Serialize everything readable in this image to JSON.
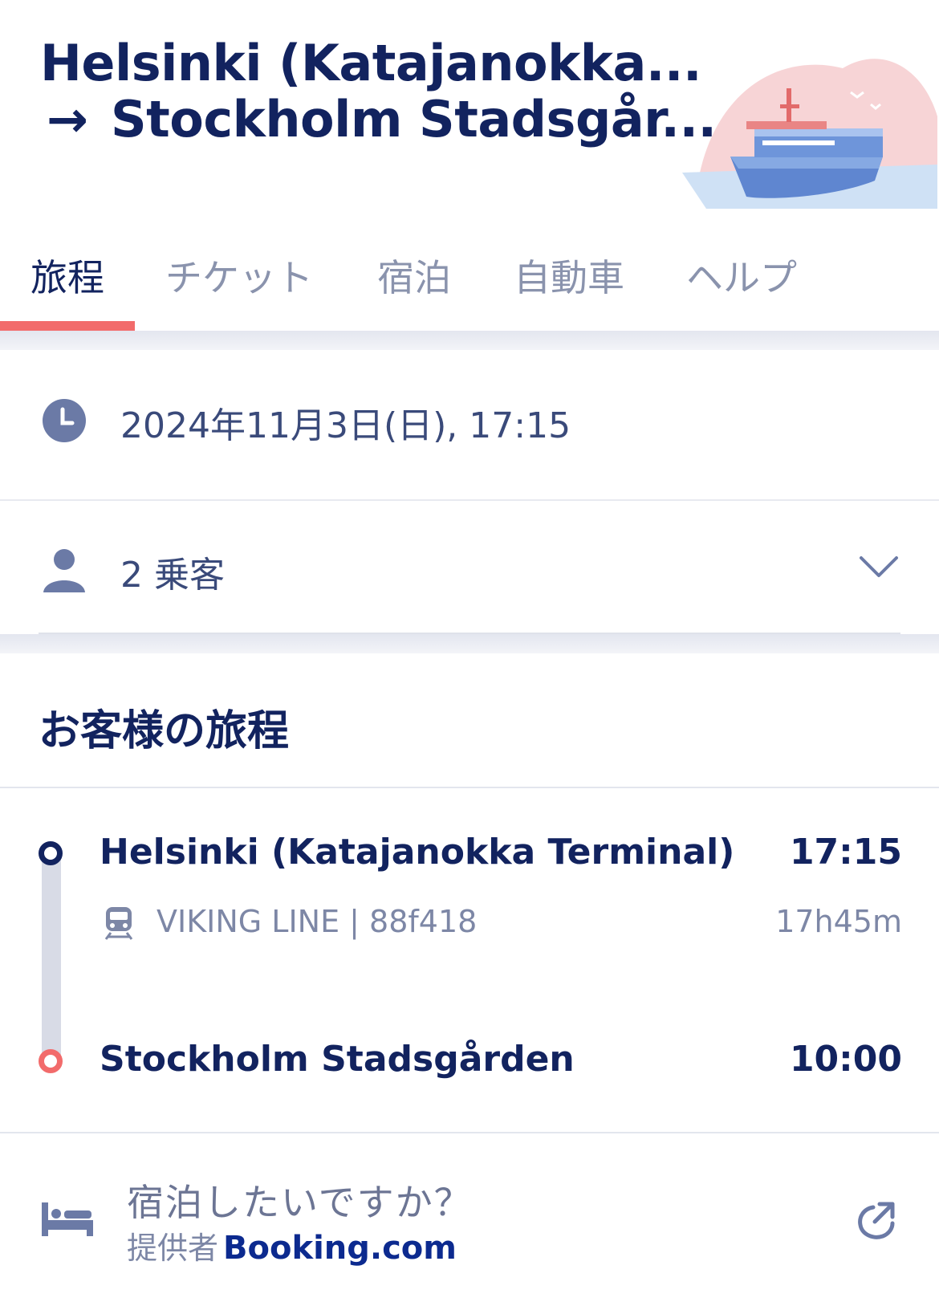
{
  "header": {
    "title_line1": "Helsinki (Katajanokka...",
    "title_line2": "Stockholm Stadsgår...",
    "arrow": "→"
  },
  "tabs": [
    {
      "label": "旅程",
      "active": true
    },
    {
      "label": "チケット",
      "active": false
    },
    {
      "label": "宿泊",
      "active": false
    },
    {
      "label": "自動車",
      "active": false
    },
    {
      "label": "ヘルプ",
      "active": false
    }
  ],
  "trip": {
    "datetime": "2024年11月3日(日), 17:15",
    "passengers": "2 乗客"
  },
  "itinerary": {
    "title": "お客様の旅程",
    "departure": {
      "name": "Helsinki (Katajanokka Terminal)",
      "time": "17:15"
    },
    "operator": "VIKING LINE | 88f418",
    "duration": "17h45m",
    "arrival": {
      "name": "Stockholm Stadsgården",
      "time": "10:00"
    }
  },
  "stay": {
    "question": "宿泊したいですか？",
    "provider_label": "提供者",
    "provider_brand": "Booking.com"
  },
  "icons": {
    "clock": "clock-icon",
    "person": "person-icon",
    "chevron": "chevron-down-icon",
    "train": "train-icon",
    "bed": "bed-icon",
    "external": "external-link-icon"
  },
  "colors": {
    "navy": "#12235f",
    "accent": "#f26b6b",
    "muted": "#7d87a6"
  }
}
